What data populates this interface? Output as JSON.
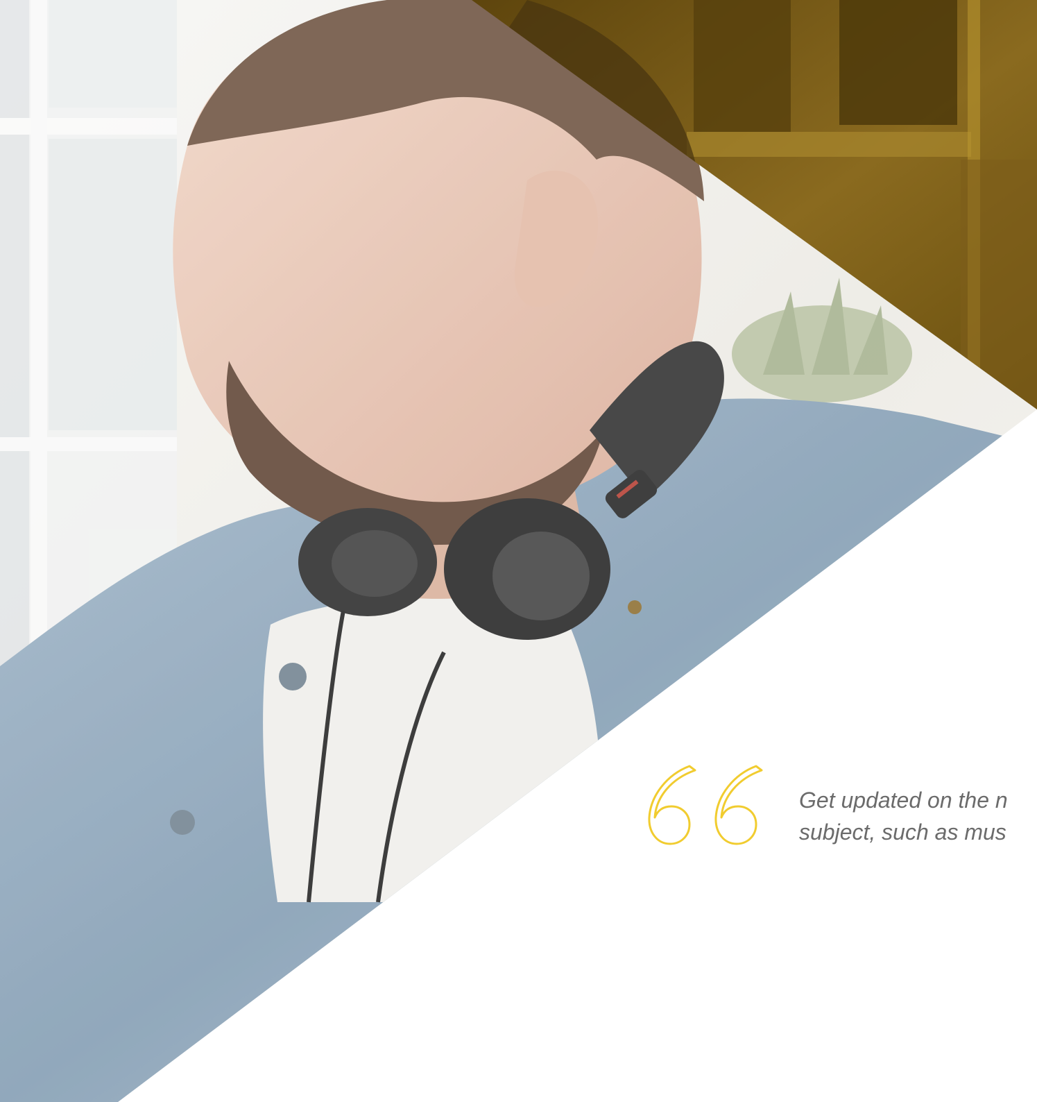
{
  "hero": {
    "background_color": "#ffffff",
    "overlay_color": "#7a5a14",
    "photo_subject": "man-with-headphones"
  },
  "quote": {
    "icon": "quote-open-icon",
    "accent_color": "#f1cc2f",
    "text": "Get updated on the n\nsubject, such as mus"
  }
}
